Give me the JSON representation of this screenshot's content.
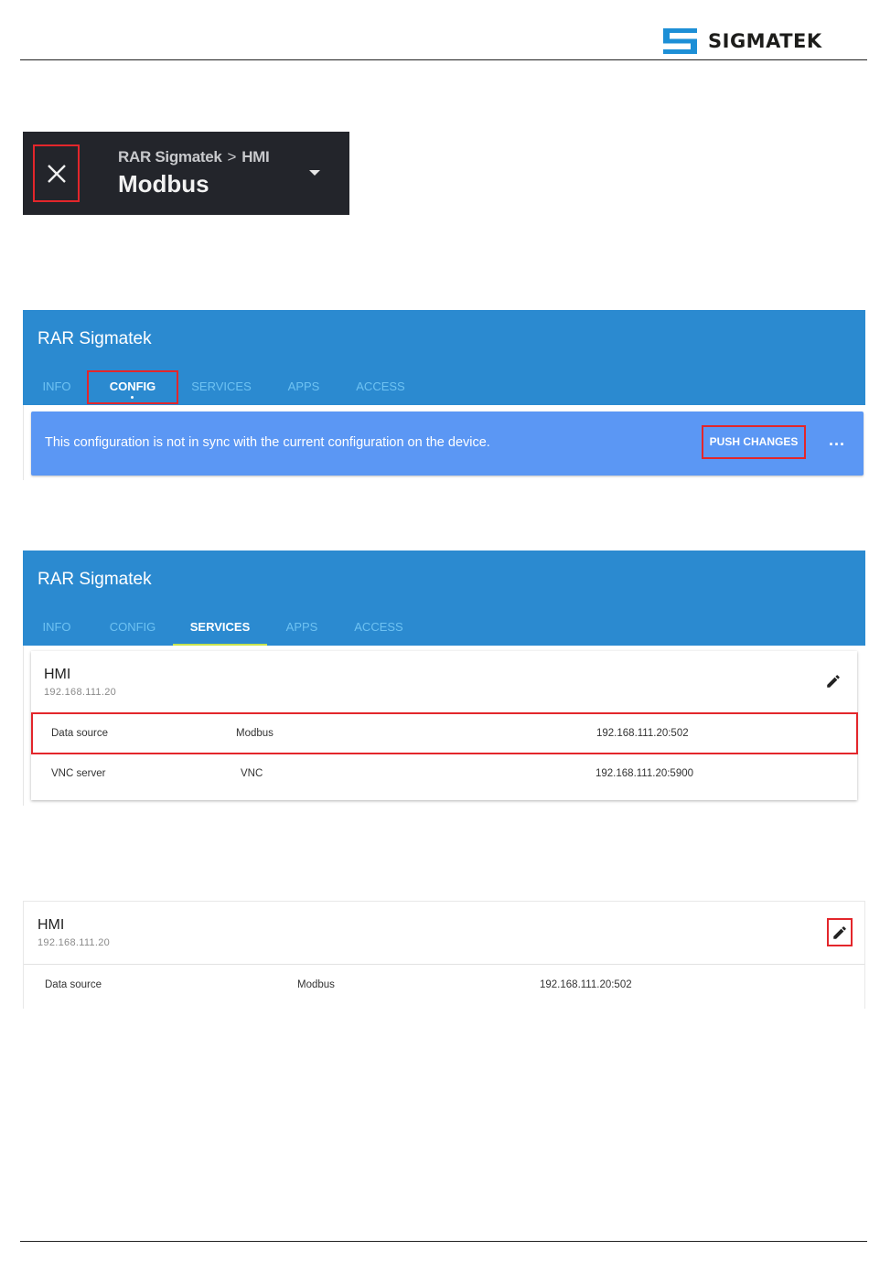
{
  "logo": {
    "text": "SIGMATEK",
    "color": "#1d8fd6"
  },
  "screen1": {
    "breadcrumb": {
      "parent": "RAR Sigmatek",
      "separator": ">",
      "child": "HMI"
    },
    "title": "Modbus",
    "icons": [
      "close-icon",
      "caret-down-icon"
    ]
  },
  "screen2": {
    "header_title": "RAR Sigmatek",
    "tabs": [
      "INFO",
      "CONFIG",
      "SERVICES",
      "APPS",
      "ACCESS"
    ],
    "active_tab": "CONFIG",
    "banner_message": "This configuration is not in sync with the current configuration on the device.",
    "push_label": "PUSH CHANGES",
    "more_label": "..."
  },
  "screen3": {
    "header_title": "RAR Sigmatek",
    "tabs": [
      "INFO",
      "CONFIG",
      "SERVICES",
      "APPS",
      "ACCESS"
    ],
    "active_tab": "SERVICES",
    "service": {
      "name": "HMI",
      "ip": "192.168.111.20"
    },
    "rows": [
      {
        "label": "Data source",
        "type": "Modbus",
        "address": "192.168.111.20:502"
      },
      {
        "label": "VNC server",
        "type": "VNC",
        "address": "192.168.111.20:5900"
      }
    ]
  },
  "screen4": {
    "service": {
      "name": "HMI",
      "ip": "192.168.111.20"
    },
    "rows": [
      {
        "label": "Data source",
        "type": "Modbus",
        "address": "192.168.111.20:502"
      }
    ]
  },
  "colors": {
    "accent_blue": "#2b8ad0",
    "banner_blue": "#5b97f4",
    "highlight_red": "#e3262b",
    "tab_inactive": "#6ec2f2",
    "tab_underline": "#c6e24f",
    "dark_header": "#23252b"
  }
}
